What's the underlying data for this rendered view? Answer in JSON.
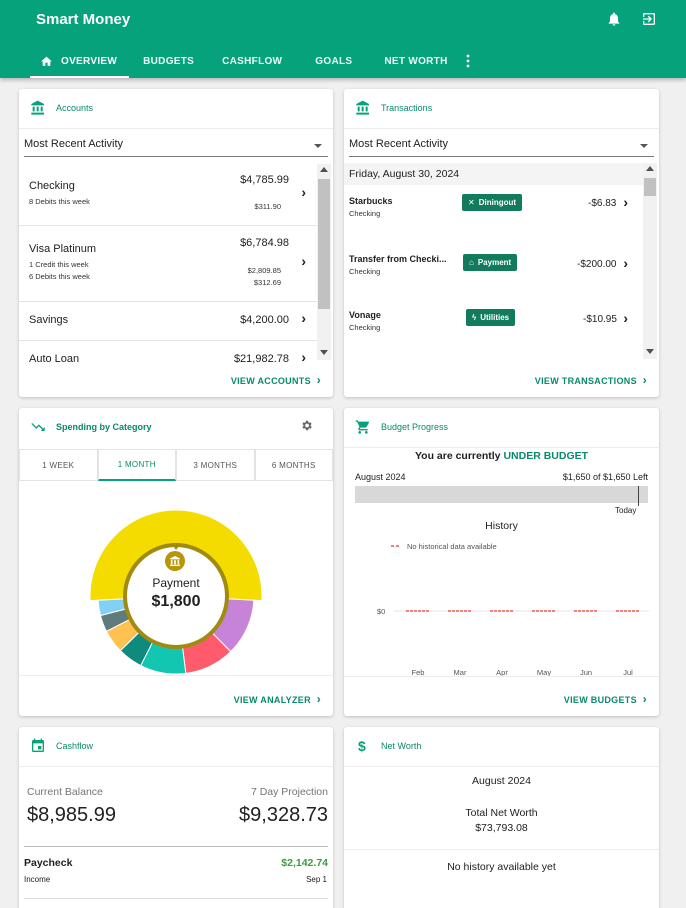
{
  "app": {
    "title": "Smart Money"
  },
  "nav": {
    "tabs": [
      {
        "label": "OVERVIEW"
      },
      {
        "label": "BUDGETS"
      },
      {
        "label": "CASHFLOW"
      },
      {
        "label": "GOALS"
      },
      {
        "label": "NET WORTH"
      }
    ]
  },
  "accounts": {
    "title": "Accounts",
    "filter": "Most Recent Activity",
    "rows": [
      {
        "name": "Checking",
        "sub1": "8 Debits this week",
        "sub2": "",
        "amount": "$4,785.99",
        "amount2": "$311.90",
        "amount3": ""
      },
      {
        "name": "Visa Platinum",
        "sub1": "1 Credit this week",
        "sub2": "6 Debits this week",
        "amount": "$6,784.98",
        "amount2": "$2,809.85",
        "amount3": "$312.69"
      },
      {
        "name": "Savings",
        "amount": "$4,200.00"
      },
      {
        "name": "Auto Loan",
        "amount": "$21,982.78"
      }
    ],
    "footer": "VIEW ACCOUNTS"
  },
  "transactions": {
    "title": "Transactions",
    "filter": "Most Recent Activity",
    "date_header": "Friday, August 30, 2024",
    "rows": [
      {
        "name": "Starbucks",
        "account": "Checking",
        "category": "Diningout",
        "amount": "-$6.83"
      },
      {
        "name": "Transfer from Checki...",
        "account": "Checking",
        "category": "Payment",
        "amount": "-$200.00"
      },
      {
        "name": "Vonage",
        "account": "Checking",
        "category": "Utilities",
        "amount": "-$10.95"
      }
    ],
    "footer": "VIEW TRANSACTIONS"
  },
  "spending": {
    "title": "Spending by Category",
    "periods": [
      "1 WEEK",
      "1 MONTH",
      "3 MONTHS",
      "6 MONTHS"
    ],
    "center_label": "Payment",
    "center_value": "$1,800",
    "footer": "VIEW ANALYZER"
  },
  "budget": {
    "title": "Budget Progress",
    "status_prefix": "You are currently",
    "status_value": "UNDER BUDGET",
    "month": "August 2024",
    "left_text": "$1,650 of $1,650 Left",
    "today_label": "Today",
    "history_title": "History",
    "legend": "No historical data available",
    "footer": "VIEW BUDGETS"
  },
  "cashflow": {
    "title": "Cashflow",
    "current_label": "Current Balance",
    "current_value": "$8,985.99",
    "projection_label": "7 Day Projection",
    "projection_value": "$9,328.73",
    "item_name": "Paycheck",
    "item_type": "Income",
    "item_amount": "$2,142.74",
    "item_date": "Sep 1"
  },
  "networth": {
    "title": "Net Worth",
    "month": "August 2024",
    "total_label": "Total Net Worth",
    "total_value": "$73,793.08",
    "history_note": "No history available yet"
  },
  "colors": {
    "brand": "#05a27b",
    "accent_text": "#088a6b",
    "badge": "#127b5e",
    "positive": "#3f9b3f"
  },
  "chart_data": [
    {
      "type": "pie",
      "title": "",
      "center_label": "Payment",
      "center_value": "$1,800",
      "categories": [
        "Payment",
        "Purple",
        "Red",
        "Teal",
        "Dark teal",
        "Orange",
        "Slate",
        "Light blue"
      ],
      "values": [
        1800,
        410,
        360,
        330,
        180,
        170,
        120,
        110
      ],
      "colors": [
        "#f5dc00",
        "#c783d8",
        "#ff5b6c",
        "#12c6b2",
        "#0f8b7d",
        "#ffc250",
        "#5f7b7a",
        "#83d0f5"
      ]
    },
    {
      "type": "line",
      "title": "History",
      "categories": [
        "Feb",
        "Mar",
        "Apr",
        "May",
        "Jun",
        "Jul"
      ],
      "y_ticks": [
        "$0"
      ],
      "series": [
        {
          "name": "No historical data available",
          "values": [
            0,
            0,
            0,
            0,
            0,
            0
          ]
        }
      ]
    }
  ]
}
